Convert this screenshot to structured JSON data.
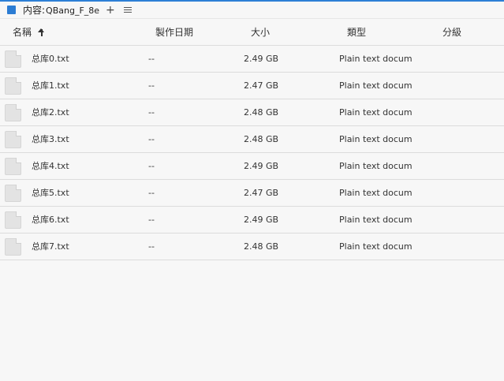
{
  "tab": {
    "prefix": "内容:",
    "name": "QBang_F_8e",
    "add_icon": "+",
    "menu_icon": "menu-icon"
  },
  "columns": {
    "name": "名稱",
    "date": "製作日期",
    "size": "大小",
    "type": "類型",
    "class": "分級"
  },
  "sort": {
    "column": "name",
    "direction": "ascending"
  },
  "files": [
    {
      "name": "总库0.txt",
      "date": "--",
      "size": "2.49 GB",
      "type": "Plain text docum..."
    },
    {
      "name": "总库1.txt",
      "date": "--",
      "size": "2.47 GB",
      "type": "Plain text docum..."
    },
    {
      "name": "总库2.txt",
      "date": "--",
      "size": "2.48 GB",
      "type": "Plain text docum..."
    },
    {
      "name": "总库3.txt",
      "date": "--",
      "size": "2.48 GB",
      "type": "Plain text docum..."
    },
    {
      "name": "总库4.txt",
      "date": "--",
      "size": "2.49 GB",
      "type": "Plain text docum..."
    },
    {
      "name": "总库5.txt",
      "date": "--",
      "size": "2.47 GB",
      "type": "Plain text docum..."
    },
    {
      "name": "总库6.txt",
      "date": "--",
      "size": "2.49 GB",
      "type": "Plain text docum..."
    },
    {
      "name": "总库7.txt",
      "date": "--",
      "size": "2.48 GB",
      "type": "Plain text docum..."
    }
  ],
  "colors": {
    "accent": "#2b7cd3",
    "background": "#f7f7f7",
    "divider": "#dcdcdc"
  }
}
